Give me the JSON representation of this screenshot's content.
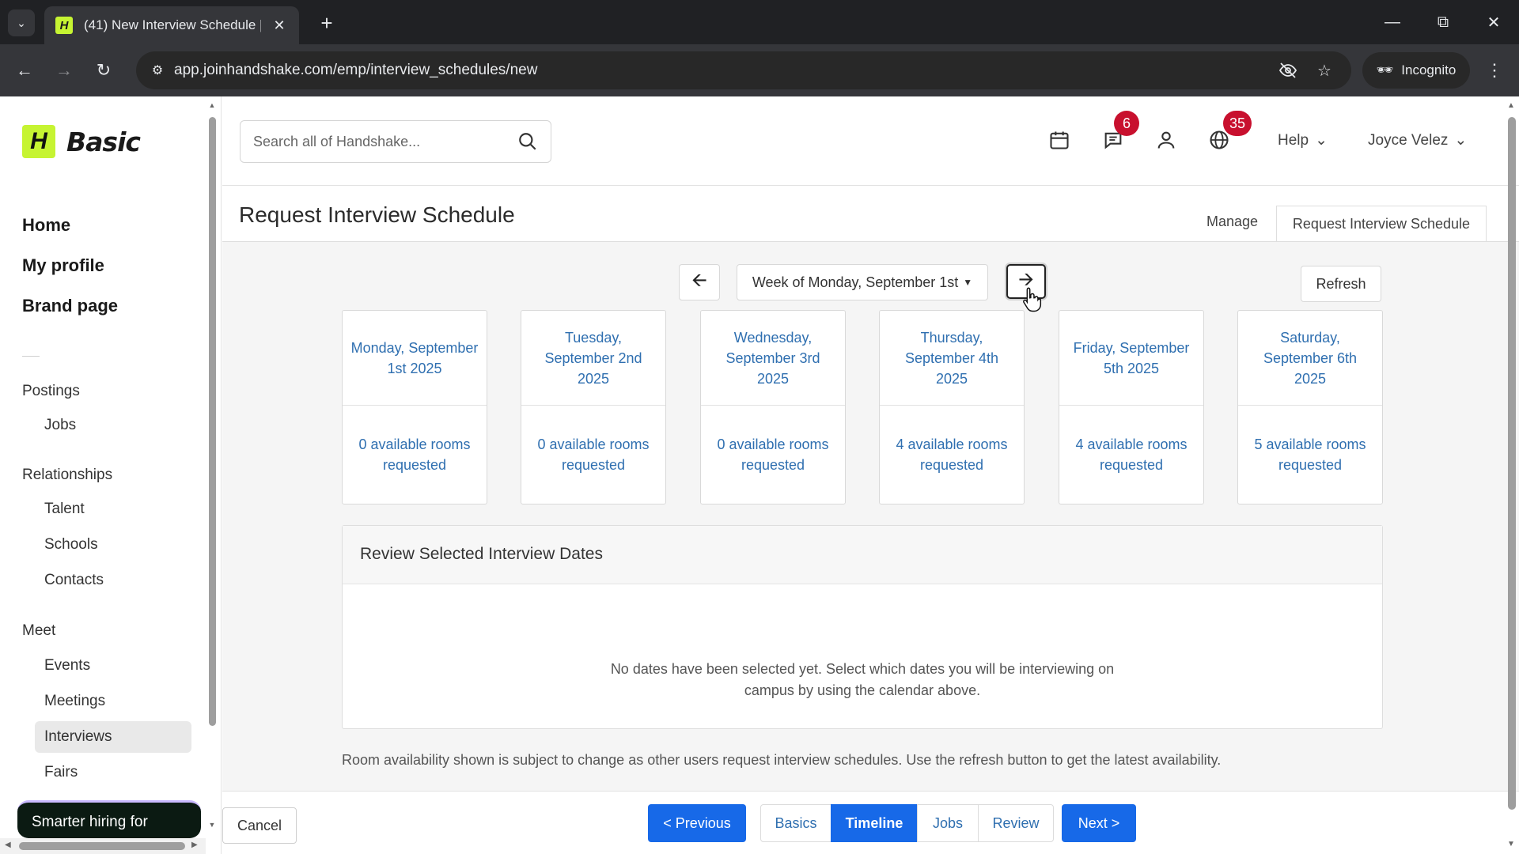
{
  "browser": {
    "tab_title": "(41) New Interview Schedule | H",
    "url": "app.joinhandshake.com/emp/interview_schedules/new",
    "incognito_label": "Incognito"
  },
  "sidebar": {
    "logo_mark": "H",
    "logo_text": "Basic",
    "top_links": [
      "Home",
      "My profile",
      "Brand page"
    ],
    "groups": {
      "postings": "Postings",
      "relationships": "Relationships",
      "meet": "Meet"
    },
    "items": {
      "jobs": "Jobs",
      "talent": "Talent",
      "schools": "Schools",
      "contacts": "Contacts",
      "events": "Events",
      "meetings": "Meetings",
      "interviews": "Interviews",
      "fairs": "Fairs"
    },
    "promo_text": "Smarter hiring for"
  },
  "header": {
    "search_placeholder": "Search all of Handshake...",
    "messages_badge": "6",
    "notifications_badge": "35",
    "help_label": "Help",
    "user_name": "Joyce Velez"
  },
  "page": {
    "title": "Request Interview Schedule",
    "tabs": {
      "manage": "Manage",
      "request": "Request Interview Schedule"
    },
    "week_label": "Week of Monday, September 1st",
    "refresh_label": "Refresh",
    "days": [
      {
        "date": "Monday, September 1st 2025",
        "rooms": "0 available rooms requested"
      },
      {
        "date": "Tuesday, September 2nd 2025",
        "rooms": "0 available rooms requested"
      },
      {
        "date": "Wednesday, September 3rd 2025",
        "rooms": "0 available rooms requested"
      },
      {
        "date": "Thursday, September 4th 2025",
        "rooms": "4 available rooms requested"
      },
      {
        "date": "Friday, September 5th 2025",
        "rooms": "4 available rooms requested"
      },
      {
        "date": "Saturday, September 6th 2025",
        "rooms": "5 available rooms requested"
      }
    ],
    "review_title": "Review Selected Interview Dates",
    "review_empty": "No dates have been selected yet. Select which dates you will be interviewing on campus by using the calendar above.",
    "disclaimer": "Room availability shown is subject to change as other users request interview schedules. Use the refresh button to get the latest availability."
  },
  "footer": {
    "cancel_label": "Cancel",
    "previous_label": "< Previous",
    "steps": [
      "Basics",
      "Timeline",
      "Jobs",
      "Review"
    ],
    "active_step": "Timeline",
    "next_label": "Next >"
  },
  "colors": {
    "brand_lime": "#c6f432",
    "link_blue": "#2f6fb0",
    "primary_blue": "#1769e8",
    "badge_red": "#c8102e"
  }
}
